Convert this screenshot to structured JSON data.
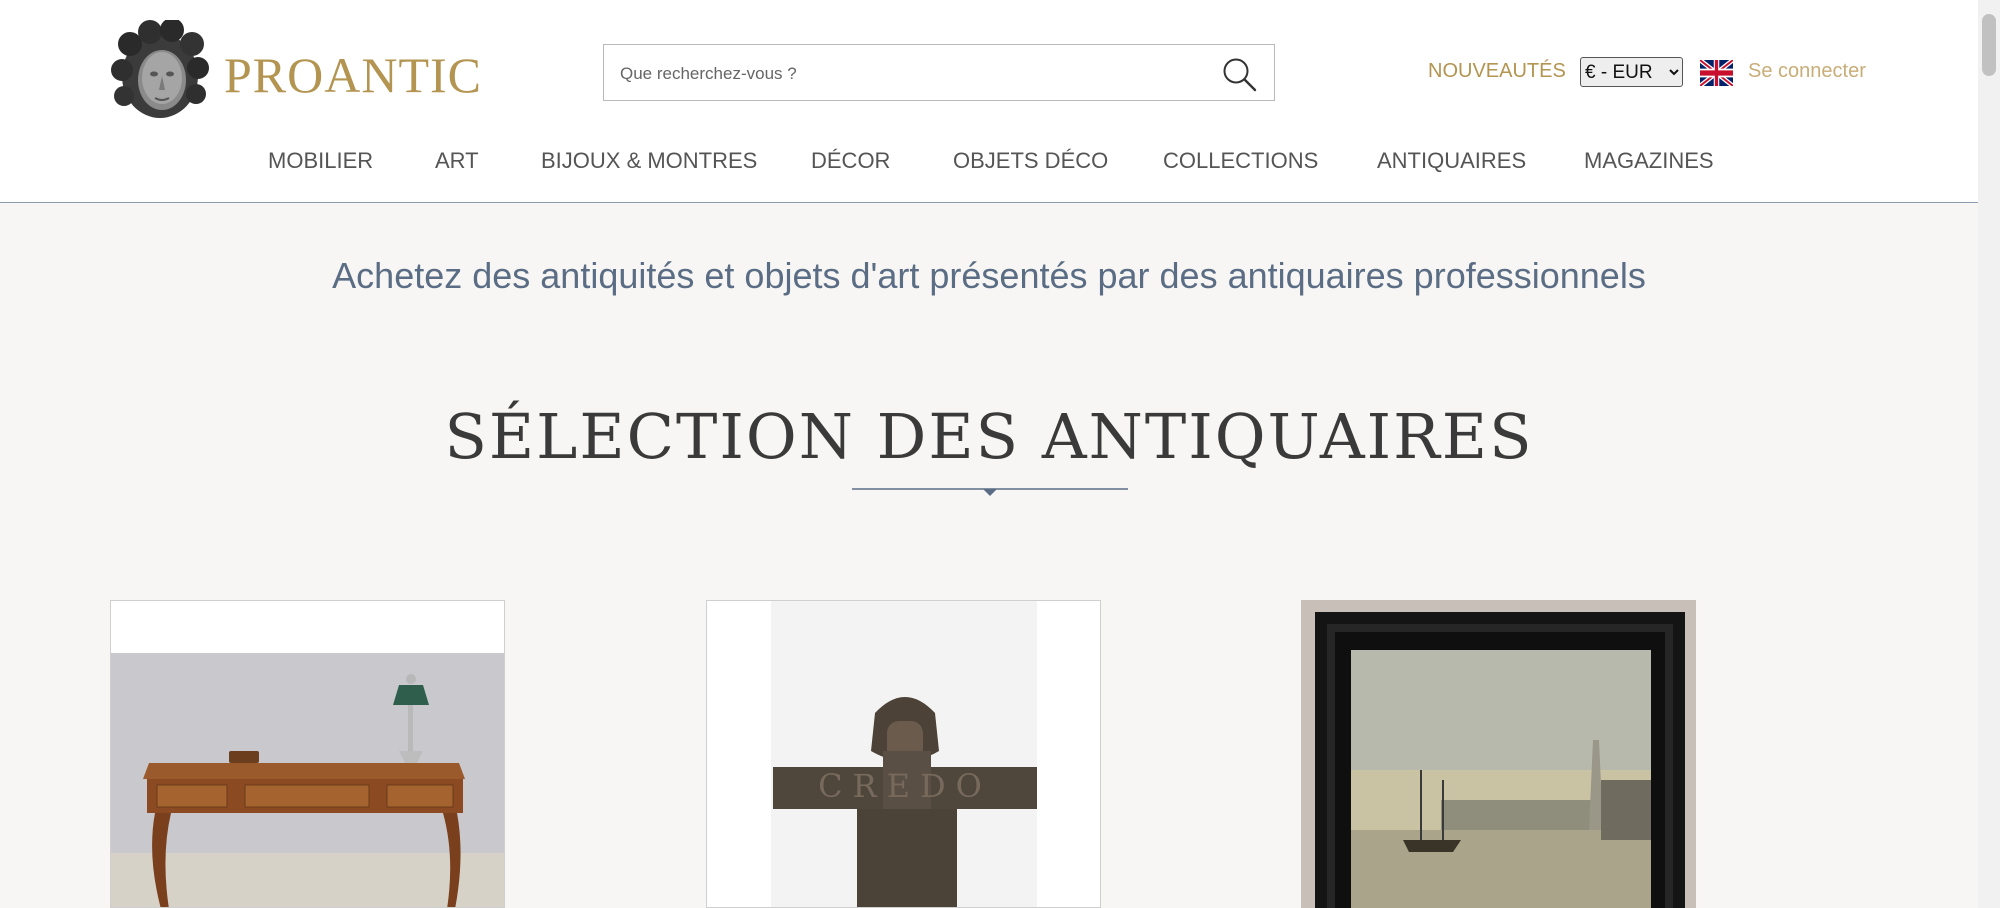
{
  "header": {
    "brand": "PROANTIC",
    "logo_icon": "classical-head-logo-icon",
    "search": {
      "placeholder": "Que recherchez-vous ?",
      "value": "",
      "icon": "search-icon"
    },
    "news_label": "NOUVEAUTÉS",
    "currency": {
      "selected": "€ - EUR"
    },
    "language_flag": "uk-flag-icon",
    "login_label": "Se connecter"
  },
  "nav": {
    "items": [
      {
        "label": "MOBILIER"
      },
      {
        "label": "ART"
      },
      {
        "label": "BIJOUX & MONTRES"
      },
      {
        "label": "DÉCOR"
      },
      {
        "label": "OBJETS DÉCO"
      },
      {
        "label": "COLLECTIONS"
      },
      {
        "label": "ANTIQUAIRES"
      },
      {
        "label": "MAGAZINES"
      }
    ]
  },
  "main": {
    "tagline": "Achetez des antiquités et objets d'art présentés par des antiquaires professionnels",
    "section_title": "SÉLECTION DES ANTIQUAIRES",
    "cards": [
      {
        "image": "antique-writing-desk-with-bouillotte-lamp"
      },
      {
        "image": "bronze-knight-credo-sculpture"
      },
      {
        "image": "framed-harbour-painting"
      }
    ]
  },
  "colors": {
    "brand_gold": "#b39451",
    "login_gold": "#c9ad78",
    "tagline_blue": "#5a6d84",
    "page_background": "#f7f6f4",
    "header_border": "#8b9bb0"
  }
}
